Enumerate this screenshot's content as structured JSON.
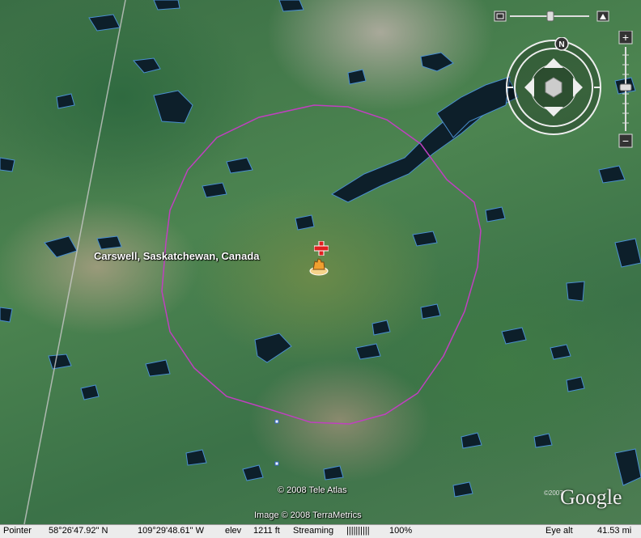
{
  "map": {
    "place_label": "Carswell, Saskatchewan, Canada",
    "copyright_data": "© 2008 Tele Atlas",
    "copyright_image": "Image © 2008 TerraMetrics",
    "logo": "Google",
    "logo_year": "©2007",
    "ring_color": "#c040c0",
    "water_color": "#0d1f2a"
  },
  "navigation": {
    "north_label": "N",
    "icons": [
      "look-icon",
      "zoom-slider-icon",
      "tilt-icon",
      "compass-icon",
      "move-up-icon",
      "move-down-icon",
      "move-left-icon",
      "move-right-icon",
      "zoom-in-icon",
      "zoom-out-icon"
    ]
  },
  "status": {
    "pointer_label": "Pointer",
    "latitude": "58°26'47.92\" N",
    "longitude": "109°29'48.61\" W",
    "elev_label": "elev",
    "elevation": "1211 ft",
    "streaming_label": "Streaming",
    "streaming_bars": "||||||||||",
    "streaming_percent": "100%",
    "eye_alt_label": "Eye alt",
    "eye_alt": "41.53 mi"
  }
}
